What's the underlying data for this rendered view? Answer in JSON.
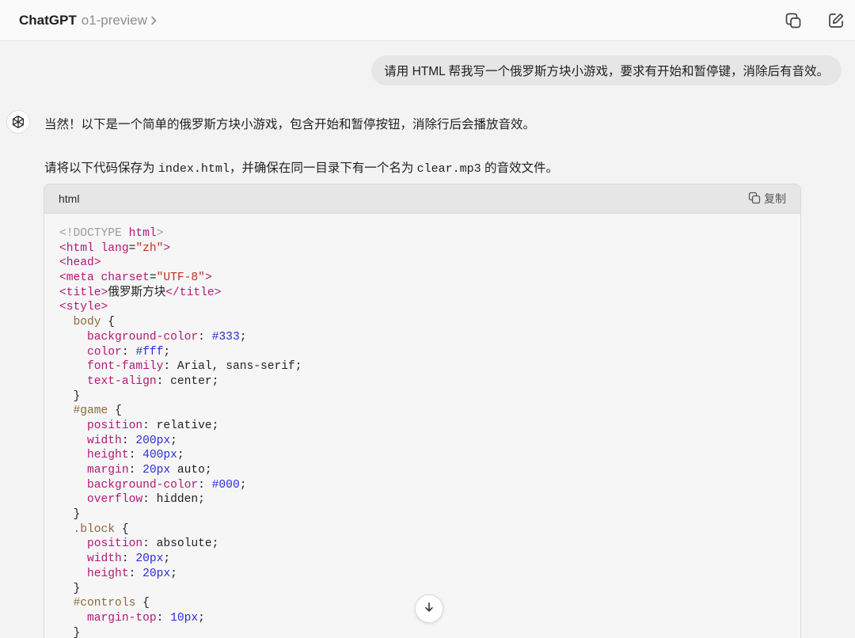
{
  "header": {
    "app_title": "ChatGPT",
    "model_name": "o1-preview",
    "icons": [
      "copy-window-icon",
      "new-chat-icon"
    ]
  },
  "user_message": "请用 HTML 帮我写一个俄罗斯方块小游戏，要求有开始和暂停键，消除后有音效。",
  "assistant": {
    "icon": "openai-logo-icon",
    "line1": "当然！以下是一个简单的俄罗斯方块小游戏，包含开始和暂停按钮，消除行后会播放音效。",
    "line2_pre": "请将以下代码保存为 ",
    "line2_file": "index.html",
    "line2_mid": "，并确保在同一目录下有一个名为 ",
    "line2_audio": "clear.mp3",
    "line2_post": " 的音效文件。"
  },
  "code_block": {
    "language": "html",
    "copy_label": "复制",
    "lines": [
      [
        [
          "muted",
          "<!DOCTYPE "
        ],
        [
          "tag",
          "html"
        ],
        [
          "muted",
          ">"
        ]
      ],
      [
        [
          "tag",
          "<html "
        ],
        [
          "attr",
          "lang"
        ],
        [
          "plain",
          "="
        ],
        [
          "str",
          "\"zh\""
        ],
        [
          "tag",
          ">"
        ]
      ],
      [
        [
          "tag",
          "<head>"
        ]
      ],
      [
        [
          "tag",
          "<meta "
        ],
        [
          "attr",
          "charset"
        ],
        [
          "plain",
          "="
        ],
        [
          "str",
          "\"UTF-8\""
        ],
        [
          "tag",
          ">"
        ]
      ],
      [
        [
          "tag",
          "<title>"
        ],
        [
          "plain",
          "俄罗斯方块"
        ],
        [
          "tag",
          "</title>"
        ]
      ],
      [
        [
          "tag",
          "<style>"
        ]
      ],
      [
        [
          "plain",
          "  "
        ],
        [
          "sel",
          "body"
        ],
        [
          "plain",
          " {"
        ]
      ],
      [
        [
          "plain",
          "    "
        ],
        [
          "prop",
          "background-color"
        ],
        [
          "plain",
          ": "
        ],
        [
          "num",
          "#333"
        ],
        [
          "plain",
          ";"
        ]
      ],
      [
        [
          "plain",
          "    "
        ],
        [
          "prop",
          "color"
        ],
        [
          "plain",
          ": "
        ],
        [
          "num",
          "#fff"
        ],
        [
          "plain",
          ";"
        ]
      ],
      [
        [
          "plain",
          "    "
        ],
        [
          "prop",
          "font-family"
        ],
        [
          "plain",
          ": Arial, sans-serif;"
        ]
      ],
      [
        [
          "plain",
          "    "
        ],
        [
          "prop",
          "text-align"
        ],
        [
          "plain",
          ": center;"
        ]
      ],
      [
        [
          "plain",
          "  }"
        ]
      ],
      [
        [
          "plain",
          "  "
        ],
        [
          "sel",
          "#game"
        ],
        [
          "plain",
          " {"
        ]
      ],
      [
        [
          "plain",
          "    "
        ],
        [
          "prop",
          "position"
        ],
        [
          "plain",
          ": relative;"
        ]
      ],
      [
        [
          "plain",
          "    "
        ],
        [
          "prop",
          "width"
        ],
        [
          "plain",
          ": "
        ],
        [
          "num",
          "200px"
        ],
        [
          "plain",
          ";"
        ]
      ],
      [
        [
          "plain",
          "    "
        ],
        [
          "prop",
          "height"
        ],
        [
          "plain",
          ": "
        ],
        [
          "num",
          "400px"
        ],
        [
          "plain",
          ";"
        ]
      ],
      [
        [
          "plain",
          "    "
        ],
        [
          "prop",
          "margin"
        ],
        [
          "plain",
          ": "
        ],
        [
          "num",
          "20px"
        ],
        [
          "plain",
          " auto;"
        ]
      ],
      [
        [
          "plain",
          "    "
        ],
        [
          "prop",
          "background-color"
        ],
        [
          "plain",
          ": "
        ],
        [
          "num",
          "#000"
        ],
        [
          "plain",
          ";"
        ]
      ],
      [
        [
          "plain",
          "    "
        ],
        [
          "prop",
          "overflow"
        ],
        [
          "plain",
          ": hidden;"
        ]
      ],
      [
        [
          "plain",
          "  }"
        ]
      ],
      [
        [
          "plain",
          "  "
        ],
        [
          "sel",
          ".block"
        ],
        [
          "plain",
          " {"
        ]
      ],
      [
        [
          "plain",
          "    "
        ],
        [
          "prop",
          "position"
        ],
        [
          "plain",
          ": absolute;"
        ]
      ],
      [
        [
          "plain",
          "    "
        ],
        [
          "prop",
          "width"
        ],
        [
          "plain",
          ": "
        ],
        [
          "num",
          "20px"
        ],
        [
          "plain",
          ";"
        ]
      ],
      [
        [
          "plain",
          "    "
        ],
        [
          "prop",
          "height"
        ],
        [
          "plain",
          ": "
        ],
        [
          "num",
          "20px"
        ],
        [
          "plain",
          ";"
        ]
      ],
      [
        [
          "plain",
          "  }"
        ]
      ],
      [
        [
          "plain",
          "  "
        ],
        [
          "sel",
          "#controls"
        ],
        [
          "plain",
          " {"
        ]
      ],
      [
        [
          "plain",
          "    "
        ],
        [
          "prop",
          "margin-top"
        ],
        [
          "plain",
          ": "
        ],
        [
          "num",
          "10px"
        ],
        [
          "plain",
          ";"
        ]
      ],
      [
        [
          "plain",
          "  }"
        ]
      ]
    ]
  },
  "scroll_button_icon": "arrow-down-icon"
}
